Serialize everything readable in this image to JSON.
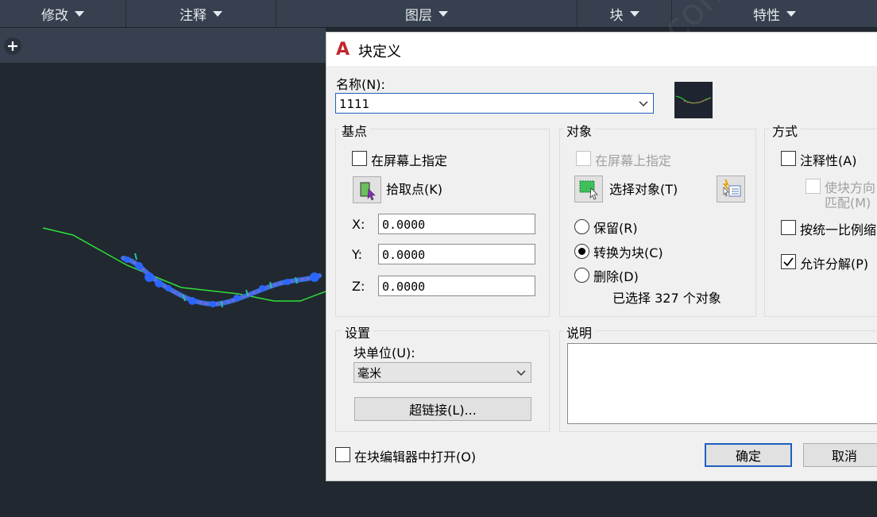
{
  "ribbon": {
    "panels": [
      "修改",
      "注释",
      "图层",
      "块",
      "特性"
    ]
  },
  "dialog": {
    "title": "块定义",
    "name_label": "名称(N):",
    "name_value": "1111",
    "base_point": {
      "group_title": "基点",
      "specify_on_screen": "在屏幕上指定",
      "pick_point": "拾取点(K)",
      "x_label": "X:",
      "x_value": "0.0000",
      "y_label": "Y:",
      "y_value": "0.0000",
      "z_label": "Z:",
      "z_value": "0.0000"
    },
    "objects": {
      "group_title": "对象",
      "specify_on_screen": "在屏幕上指定",
      "select_objects": "选择对象(T)",
      "retain": "保留(R)",
      "convert_to_block": "转换为块(C)",
      "delete": "删除(D)",
      "selected_count": "已选择 327 个对象"
    },
    "behavior": {
      "group_title": "方式",
      "annotative": "注释性(A)",
      "match_orientation_1": "使块方向",
      "match_orientation_2": "匹配(M)",
      "scale_uniformly": "按统一比例缩",
      "allow_exploding": "允许分解(P)",
      "allow_exploding_checked": true
    },
    "settings": {
      "group_title": "设置",
      "block_unit_label": "块单位(U):",
      "block_unit_value": "毫米",
      "hyperlink": "超链接(L)..."
    },
    "description": {
      "group_title": "说明"
    },
    "open_in_editor": "在块编辑器中打开(O)",
    "ok": "确定",
    "cancel": "取消"
  },
  "watermark": "图大CAD www.zzzcad.com",
  "colors": {
    "canvas_bg": "#212830",
    "ribbon_bg": "#36404e",
    "dialog_bg": "#f0f0f0",
    "accent_blue": "#1f5fbf",
    "polyline_green": "#2ee03a"
  }
}
